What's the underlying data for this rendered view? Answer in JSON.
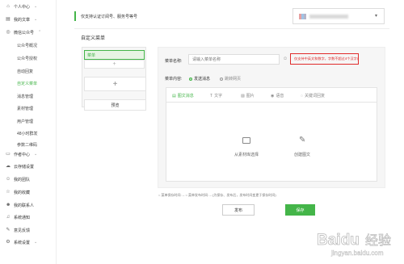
{
  "sidebar": {
    "items": [
      {
        "label": "个人中心",
        "icon": "home-icon",
        "chevron": "⌄"
      },
      {
        "label": "我的文章",
        "icon": "document-icon",
        "chevron": "⌄"
      },
      {
        "label": "微信公众号",
        "icon": "wechat-icon",
        "chevron": "⌃"
      },
      {
        "label": "作者中心",
        "icon": "author-icon",
        "chevron": "⌄"
      },
      {
        "label": "云存储设置",
        "icon": "cloud-icon"
      },
      {
        "label": "我的团队",
        "icon": "team-icon"
      },
      {
        "label": "我的收藏",
        "icon": "star-icon"
      },
      {
        "label": "我的联系人",
        "icon": "contacts-icon"
      },
      {
        "label": "系统通知",
        "icon": "bell-icon"
      },
      {
        "label": "意见反馈",
        "icon": "feedback-icon"
      },
      {
        "label": "系统设置",
        "icon": "gear-icon",
        "chevron": "⌄"
      }
    ],
    "subitems": [
      {
        "label": "公众号概况"
      },
      {
        "label": "公众号授权"
      },
      {
        "label": "自动回复"
      },
      {
        "label": "自定义菜单",
        "active": true
      },
      {
        "label": "消息管理"
      },
      {
        "label": "素材管理"
      },
      {
        "label": "用户管理"
      },
      {
        "label": "48小时群发"
      },
      {
        "label": "参数二维码"
      }
    ]
  },
  "header": {
    "notice": "仅支持认证订阅号、服务号等号",
    "account_dropdown": "▾"
  },
  "section_title": "自定义菜单",
  "phone_preview": {
    "menu_item": "菜单",
    "add_submenu": "+",
    "add_menu": "+",
    "preview_button": "预览"
  },
  "editor": {
    "name_label": "菜单名称:",
    "name_placeholder": "请输入菜单名称",
    "emoji": "☺",
    "hint": "仅支持中英文和数字，字数不超过4个汉字或8个字母",
    "content_label": "菜单内容:",
    "radio_send": "发送消息",
    "radio_jump": "跳转网页",
    "tabs": [
      {
        "label": "图文消息",
        "icon": "▤"
      },
      {
        "label": "文字",
        "icon": "T"
      },
      {
        "label": "图片",
        "icon": "▨"
      },
      {
        "label": "语音",
        "icon": "◉"
      },
      {
        "label": "关键词回复",
        "icon": "◌"
      }
    ],
    "from_library": "从素材库选择",
    "create_article": "创建图文",
    "create_icon": "✎"
  },
  "footer": {
    "note": "○ 菜单保存时间: --    ○ 菜单发布时间: --    (为保存、发布后，发布时间变更于保存时间)",
    "publish": "发布",
    "save": "保存"
  },
  "watermark": {
    "brand": "Baidu",
    "cn": "经验",
    "url": "jingyan.baidu.com"
  },
  "colors": {
    "accent": "#44b549",
    "alert": "#e02b2b"
  }
}
